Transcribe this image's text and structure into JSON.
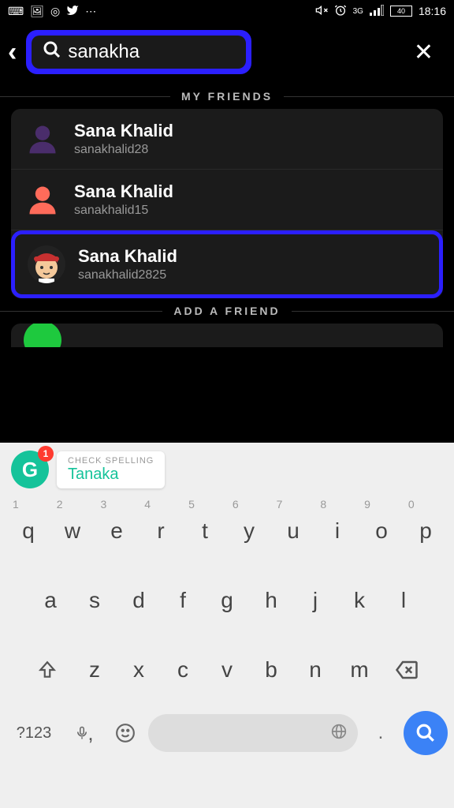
{
  "status": {
    "time": "18:16",
    "battery": "40",
    "network": "3G"
  },
  "search": {
    "value": "sanakha"
  },
  "sections": {
    "my_friends": "MY FRIENDS",
    "add_friend": "ADD A FRIEND"
  },
  "friends": [
    {
      "name": "Sana Khalid",
      "username": "sanakhalid28",
      "avatar_color": "purple"
    },
    {
      "name": "Sana Khalid",
      "username": "sanakhalid15",
      "avatar_color": "coral"
    },
    {
      "name": "Sana Khalid",
      "username": "sanakhalid2825",
      "avatar_color": "bitmoji"
    }
  ],
  "spelling": {
    "label": "CHECK SPELLING",
    "suggestion": "Tanaka",
    "badge": "1"
  },
  "keyboard": {
    "numbers": [
      "1",
      "2",
      "3",
      "4",
      "5",
      "6",
      "7",
      "8",
      "9",
      "0"
    ],
    "row1": [
      "q",
      "w",
      "e",
      "r",
      "t",
      "y",
      "u",
      "i",
      "o",
      "p"
    ],
    "row2": [
      "a",
      "s",
      "d",
      "f",
      "g",
      "h",
      "j",
      "k",
      "l"
    ],
    "row3": [
      "z",
      "x",
      "c",
      "v",
      "b",
      "n",
      "m"
    ],
    "sym": "?123",
    "dot": "."
  }
}
